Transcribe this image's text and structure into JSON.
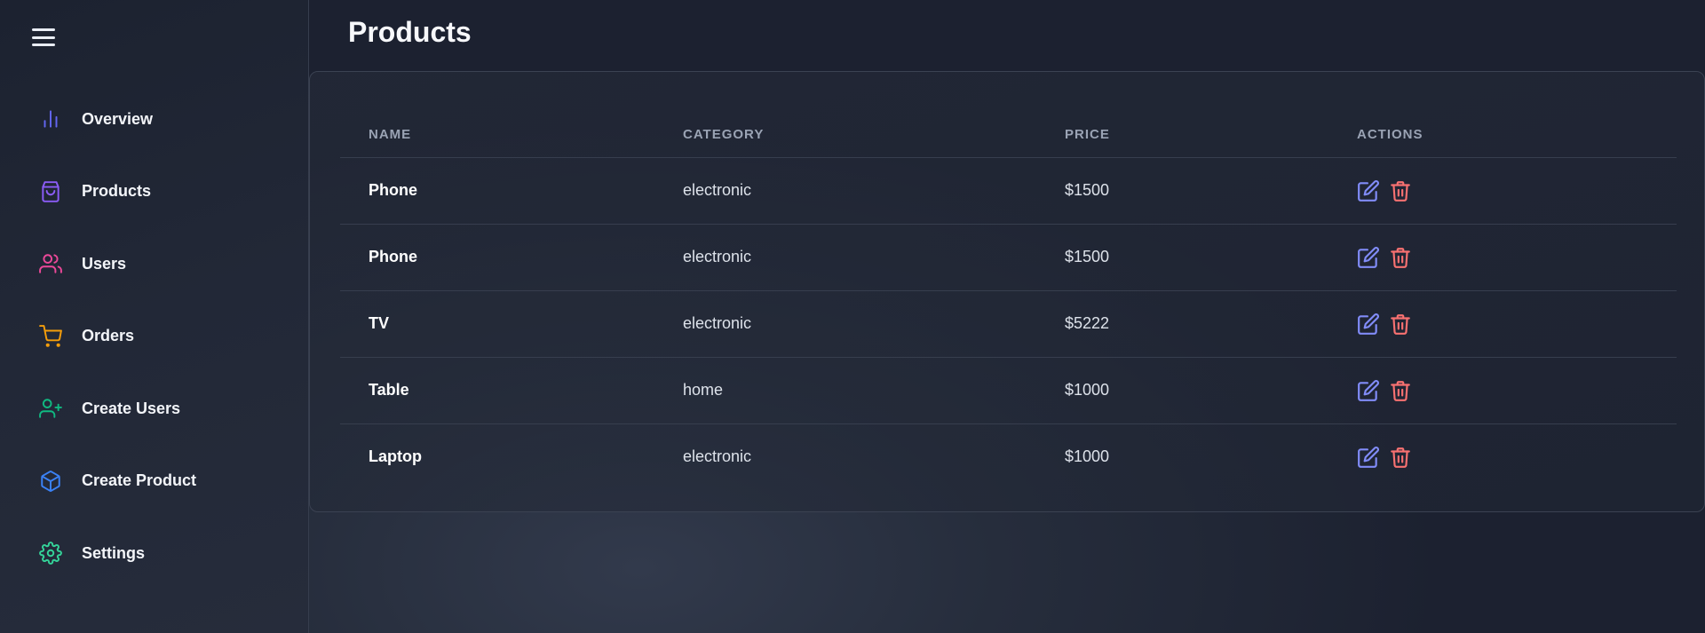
{
  "sidebar": {
    "items": [
      {
        "label": "Overview",
        "icon": "bar-chart-icon",
        "color": "#6366f1"
      },
      {
        "label": "Products",
        "icon": "shopping-bag-icon",
        "color": "#8b5cf6"
      },
      {
        "label": "Users",
        "icon": "users-icon",
        "color": "#ec4899"
      },
      {
        "label": "Orders",
        "icon": "shopping-cart-icon",
        "color": "#f59e0b"
      },
      {
        "label": "Create Users",
        "icon": "user-plus-icon",
        "color": "#10b981"
      },
      {
        "label": "Create Product",
        "icon": "box-icon",
        "color": "#3b82f6"
      },
      {
        "label": "Settings",
        "icon": "settings-icon",
        "color": "#34d399"
      }
    ]
  },
  "main": {
    "title": "Products",
    "table": {
      "headers": [
        "NAME",
        "CATEGORY",
        "PRICE",
        "ACTIONS"
      ],
      "rows": [
        {
          "name": "Phone",
          "category": "electronic",
          "price": "$1500"
        },
        {
          "name": "Phone",
          "category": "electronic",
          "price": "$1500"
        },
        {
          "name": "TV",
          "category": "electronic",
          "price": "$5222"
        },
        {
          "name": "Table",
          "category": "home",
          "price": "$1000"
        },
        {
          "name": "Laptop",
          "category": "electronic",
          "price": "$1000"
        }
      ]
    }
  },
  "colors": {
    "edit_icon": "#818cf8",
    "delete_icon": "#f87171"
  }
}
